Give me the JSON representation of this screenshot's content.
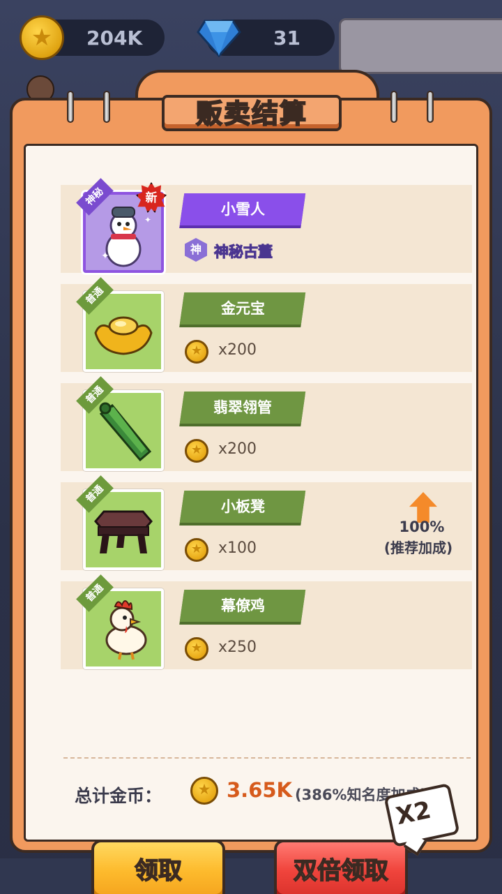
{
  "hud": {
    "gold_amount": "204K",
    "gem_amount": "31",
    "icons": [
      "gold-coin-icon",
      "blue-gem-icon",
      "player-avatar"
    ]
  },
  "dialog": {
    "title": "贩卖结算",
    "items": [
      {
        "name": "小雪人",
        "quality_tag": "神秘",
        "is_new": true,
        "new_label": "新",
        "rarity_symbol": "神",
        "rarity_label": "神秘古董",
        "image": "snowman-icon",
        "plate_color": "#8a4fea"
      },
      {
        "name": "金元宝",
        "quality_tag": "普通",
        "price": "x200",
        "image": "gold-ingot-icon",
        "plate_color": "#6f9642"
      },
      {
        "name": "翡翠翎管",
        "quality_tag": "普通",
        "price": "x200",
        "image": "jade-tube-icon",
        "plate_color": "#6f9642"
      },
      {
        "name": "小板凳",
        "quality_tag": "普通",
        "price": "x100",
        "image": "stool-icon",
        "bonus_percent": "100%",
        "bonus_label": "(推荐加成)",
        "plate_color": "#6f9642"
      },
      {
        "name": "幕僚鸡",
        "quality_tag": "普通",
        "price": "x250",
        "image": "rooster-icon",
        "plate_color": "#6f9642"
      }
    ],
    "total_label": "总计金币：",
    "total_value": "3.65K",
    "total_bonus": "(386%知名度加成)",
    "claim_label": "领取",
    "double_claim_label": "双倍领取",
    "double_badge": "X2"
  },
  "colors": {
    "frame_orange": "#f19a5e",
    "paper": "#fbf5ee",
    "total_value_orange": "#d65a1b",
    "claim_yellow": "#fdbb2d",
    "double_red": "#f0443c"
  }
}
